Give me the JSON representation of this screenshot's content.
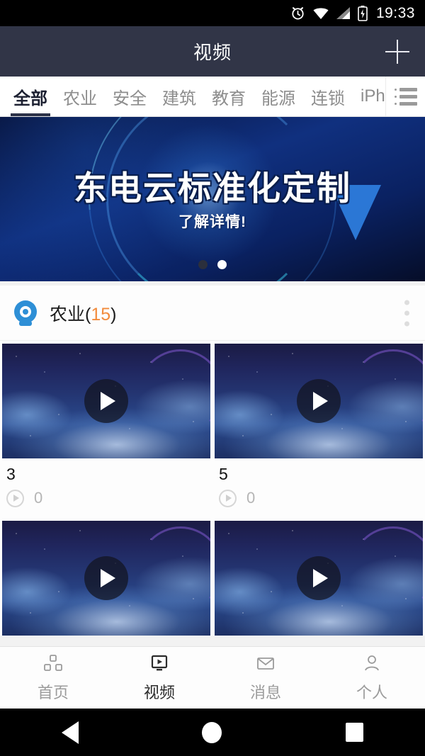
{
  "status_bar": {
    "time": "19:33",
    "icons": [
      "alarm-icon",
      "wifi-icon",
      "cellular-signal-icon",
      "battery-charging-icon"
    ]
  },
  "app_bar": {
    "title": "视频",
    "add_label": "+"
  },
  "category_tabs": {
    "items": [
      {
        "label": "全部",
        "active": true
      },
      {
        "label": "农业",
        "active": false
      },
      {
        "label": "安全",
        "active": false
      },
      {
        "label": "建筑",
        "active": false
      },
      {
        "label": "教育",
        "active": false
      },
      {
        "label": "能源",
        "active": false
      },
      {
        "label": "连锁",
        "active": false
      },
      {
        "label": "iPhone",
        "active": false
      }
    ],
    "menu_icon": "list-menu-icon"
  },
  "banner": {
    "headline": "东电云标准化定制",
    "subline": "了解详情!",
    "dots": [
      {
        "active": false
      },
      {
        "active": true
      }
    ]
  },
  "section": {
    "icon": "webcam-icon",
    "name": "农业",
    "open_paren": "(",
    "count": "15",
    "close_paren": ")",
    "more_icon": "kebab-menu-icon"
  },
  "videos": [
    {
      "title": "3",
      "views": "0",
      "play_icon": "play-icon"
    },
    {
      "title": "5",
      "views": "0",
      "play_icon": "play-icon"
    },
    {
      "title": "",
      "views": "",
      "play_icon": "play-icon"
    },
    {
      "title": "",
      "views": "",
      "play_icon": "play-icon"
    }
  ],
  "bottom_nav": {
    "items": [
      {
        "label": "首页",
        "icon": "blocks-icon",
        "active": false
      },
      {
        "label": "视频",
        "icon": "video-monitor-icon",
        "active": true
      },
      {
        "label": "消息",
        "icon": "envelope-icon",
        "active": false
      },
      {
        "label": "个人",
        "icon": "person-icon",
        "active": false
      }
    ]
  },
  "android_nav": {
    "back": "back-triangle-icon",
    "home": "home-circle-icon",
    "recents": "recents-square-icon"
  },
  "colors": {
    "header_bg": "#313547",
    "accent_orange": "#f28b3c",
    "accent_blue": "#2e8fd6",
    "active_tab": "#1d2132"
  }
}
